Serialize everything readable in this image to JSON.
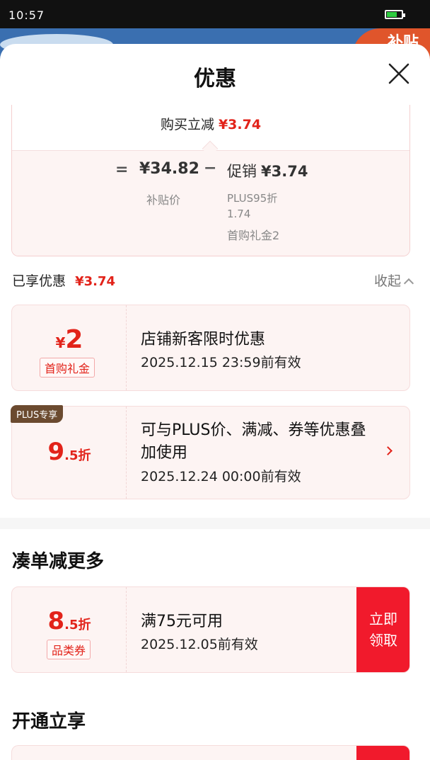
{
  "status_bar": {
    "time": "10:57"
  },
  "backdrop": {
    "badge_text": "补贴"
  },
  "sheet": {
    "title": "优惠"
  },
  "calc": {
    "reduce_label": "购买立减",
    "reduce_amount": "¥3.74",
    "equals": "=",
    "subsidy_price": "¥34.82",
    "minus": "−",
    "promo_label": "促销",
    "promo_amount": "¥3.74",
    "subsidy_label": "补贴价",
    "plus_line1": "PLUS95折",
    "plus_line2": "1.74",
    "first_gift": "首购礼金2"
  },
  "enjoyed": {
    "label": "已享优惠",
    "amount": "¥3.74",
    "collapse_label": "收起"
  },
  "coupons": [
    {
      "yen": "¥",
      "value": "2",
      "tag": "首购礼金",
      "title": "店铺新客限时优惠",
      "validity": "2025.12.15 23:59前有效"
    },
    {
      "badge": "PLUS专享",
      "value": "9",
      "unit": ".5折",
      "title": "可与PLUS价、满减、券等优惠叠加使用",
      "validity": "2025.12.24 00:00前有效"
    }
  ],
  "section_more": {
    "title": "凑单减更多",
    "coupon": {
      "value": "8",
      "unit": ".5折",
      "tag": "品类券",
      "title": "满75元可用",
      "validity": "2025.12.05前有效",
      "claim_label_1": "立即",
      "claim_label_2": "领取"
    }
  },
  "section_open": {
    "title": "开通立享"
  }
}
